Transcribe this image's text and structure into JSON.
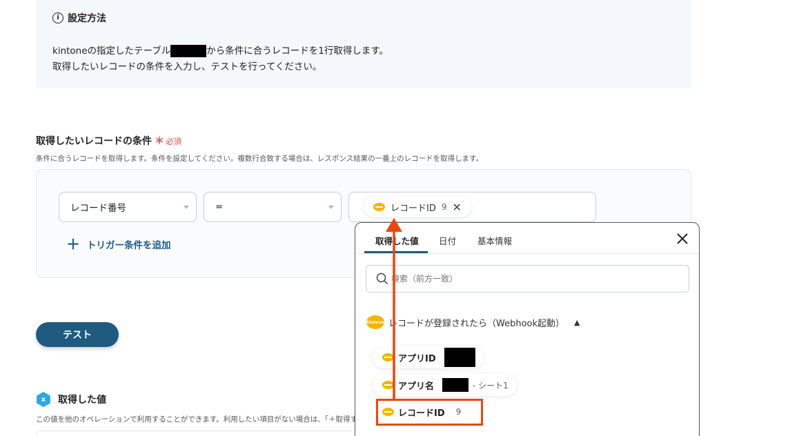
{
  "info": {
    "title": "設定方法",
    "line1_pre": "kintoneの指定したテーブル",
    "line1_post": "から条件に合うレコードを1行取得します。",
    "line2": "取得したいレコードの条件を入力し、テストを行ってください。"
  },
  "condition": {
    "title": "取得したいレコードの条件",
    "required_mark": "＊",
    "required_text": "必須",
    "description": "条件に合うレコードを取得します。条件を設定してください。複数行合致する場合は、レスポンス結果の一番上のレコードを取得します。",
    "field_select": "レコード番号",
    "operator_select": "=",
    "value_chip": {
      "label": "レコードID",
      "value": "9"
    },
    "add_trigger": "トリガー条件を追加"
  },
  "test_button": "テスト",
  "got_values": {
    "title": "取得した値",
    "description": "この値を他のオペレーションで利用することができます。利用したい項目がない場合は、「＋取得する値を追加」から項目を追加してください。"
  },
  "popup": {
    "tabs": [
      "取得した値",
      "日付",
      "基本情報"
    ],
    "active_tab": 0,
    "search_placeholder": "検索（前方一致）",
    "section_title": "レコードが登録されたら（Webhook起動）",
    "section_icon_text": "kintone",
    "items": [
      {
        "label": "アプリID",
        "value": ""
      },
      {
        "label": "アプリ名",
        "value": "- シート1"
      },
      {
        "label": "レコードID",
        "value": "9"
      }
    ]
  },
  "colors": {
    "accent": "#1f5a80",
    "required": "#e5484d",
    "annotation": "#e8470e",
    "kintone": "#f5b400"
  }
}
